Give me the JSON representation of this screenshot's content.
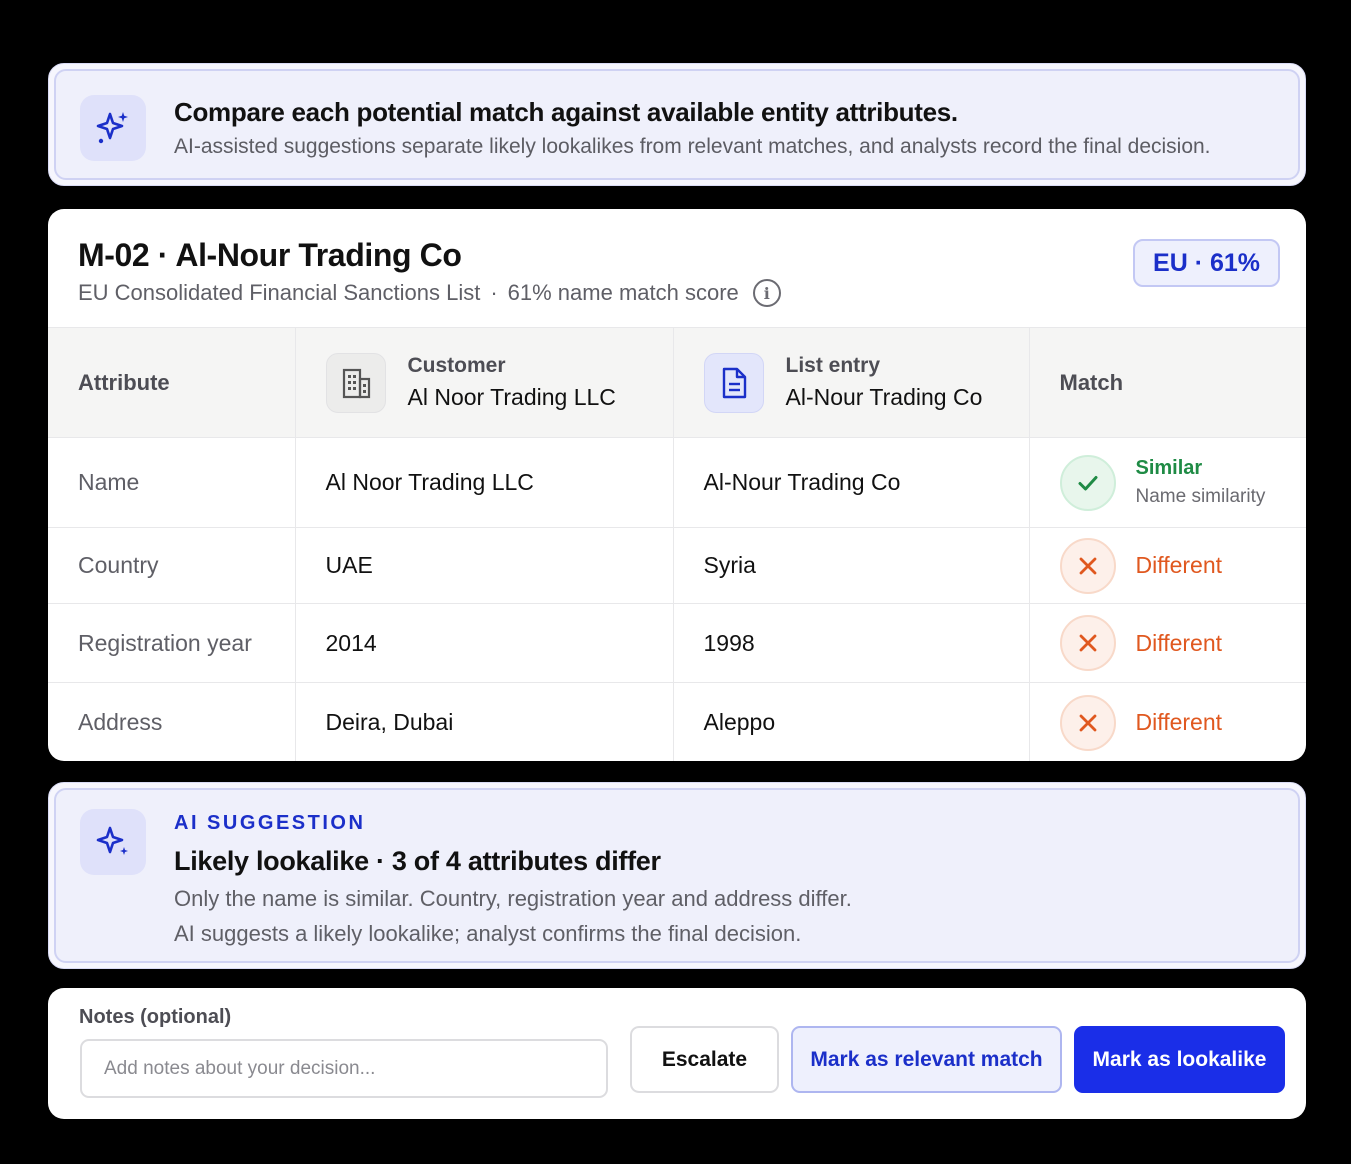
{
  "banner": {
    "icon": "sparkle-icon",
    "title": "Compare each potential match against available entity attributes.",
    "subtitle": "AI-assisted suggestions separate likely lookalikes from relevant matches, and analysts record the final decision."
  },
  "match_card": {
    "title": "M-02 · Al-Nour Trading Co",
    "list_name": "EU Consolidated Financial Sanctions List",
    "separator": "·",
    "score_text": "61% name match score",
    "badge": "EU · 61%",
    "columns": {
      "attribute": "Attribute",
      "customer_label": "Customer",
      "customer_name": "Al Noor Trading LLC",
      "list_label": "List entry",
      "list_name": "Al-Nour Trading Co",
      "match": "Match"
    },
    "rows": [
      {
        "attribute": "Name",
        "customer": "Al Noor Trading LLC",
        "list": "Al-Nour Trading Co",
        "match": "Similar",
        "match_sub": "Name similarity"
      },
      {
        "attribute": "Country",
        "customer": "UAE",
        "list": "Syria",
        "match": "Different"
      },
      {
        "attribute": "Registration year",
        "customer": "2014",
        "list": "1998",
        "match": "Different"
      },
      {
        "attribute": "Address",
        "customer": "Deira, Dubai",
        "list": "Aleppo",
        "match": "Different"
      }
    ]
  },
  "suggestion": {
    "tag": "AI SUGGESTION",
    "title": "Likely lookalike · 3 of 4 attributes differ",
    "line1": "Only the name is similar. Country, registration year and address differ.",
    "line2": "AI suggests a likely lookalike; analyst confirms the final decision."
  },
  "actions": {
    "notes_label": "Notes (optional)",
    "notes_placeholder": "Add notes about your decision...",
    "notes_value": "",
    "escalate": "Escalate",
    "mark_relevant": "Mark as relevant match",
    "mark_lookalike": "Mark as lookalike"
  },
  "colors": {
    "accent": "#1a2ee8",
    "similar": "#1f8b45",
    "different": "#e0581f"
  }
}
